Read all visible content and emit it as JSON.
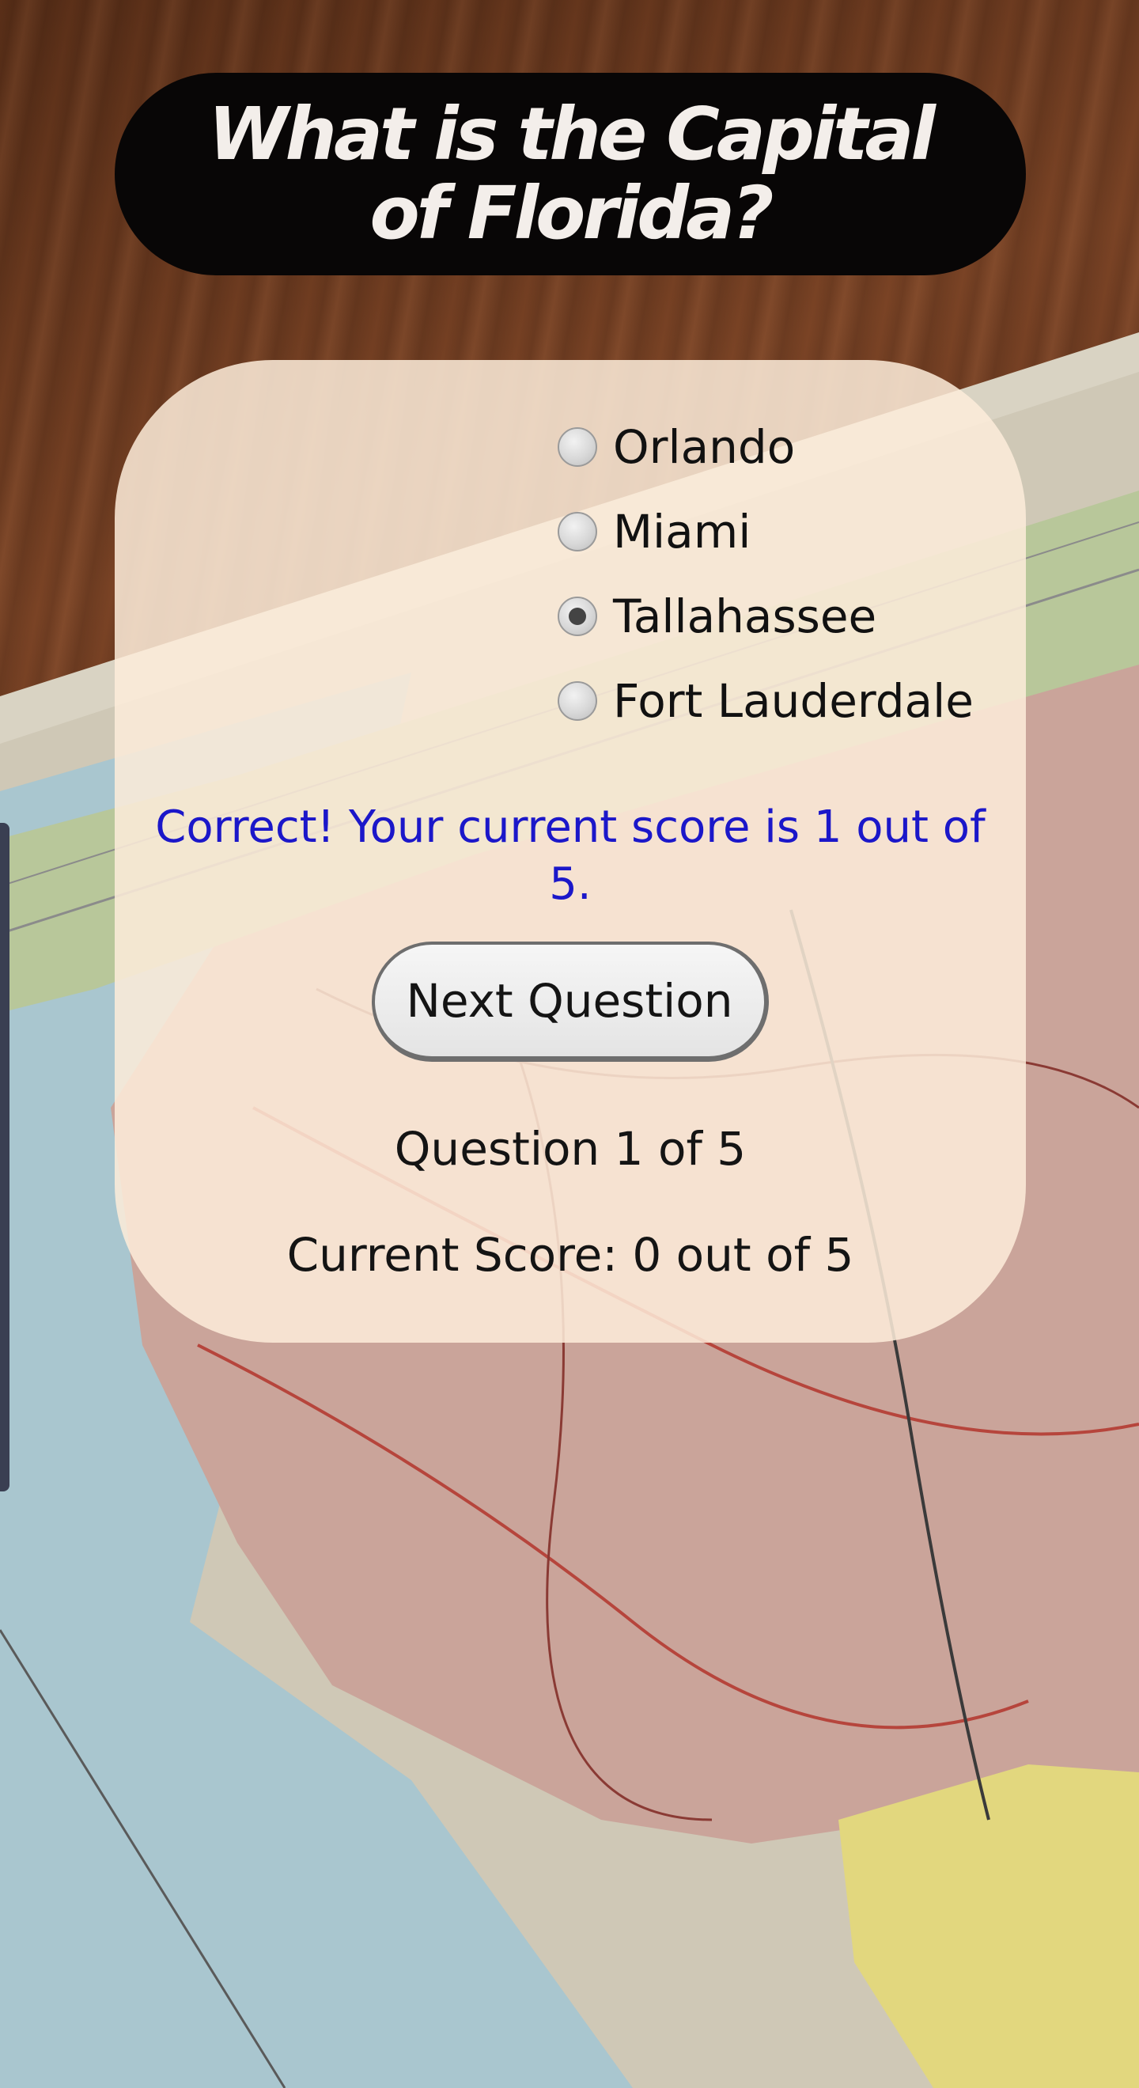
{
  "question": {
    "title": "What is the Capital of Florida?"
  },
  "options": [
    {
      "label": "Orlando",
      "selected": false
    },
    {
      "label": "Miami",
      "selected": false
    },
    {
      "label": "Tallahassee",
      "selected": true
    },
    {
      "label": "Fort Lauderdale",
      "selected": false
    }
  ],
  "feedback": {
    "text": "Correct! Your current score is 1 out of 5.",
    "color": "#1b17c9"
  },
  "next_button": {
    "label": "Next Question"
  },
  "progress": {
    "question_text": "Question 1 of 5",
    "score_text": "Current Score: 0 out of 5"
  },
  "theme": {
    "title_background": "#080606",
    "title_color": "#f3eeea",
    "card_background": "rgba(253, 236, 218, 0.86)"
  }
}
